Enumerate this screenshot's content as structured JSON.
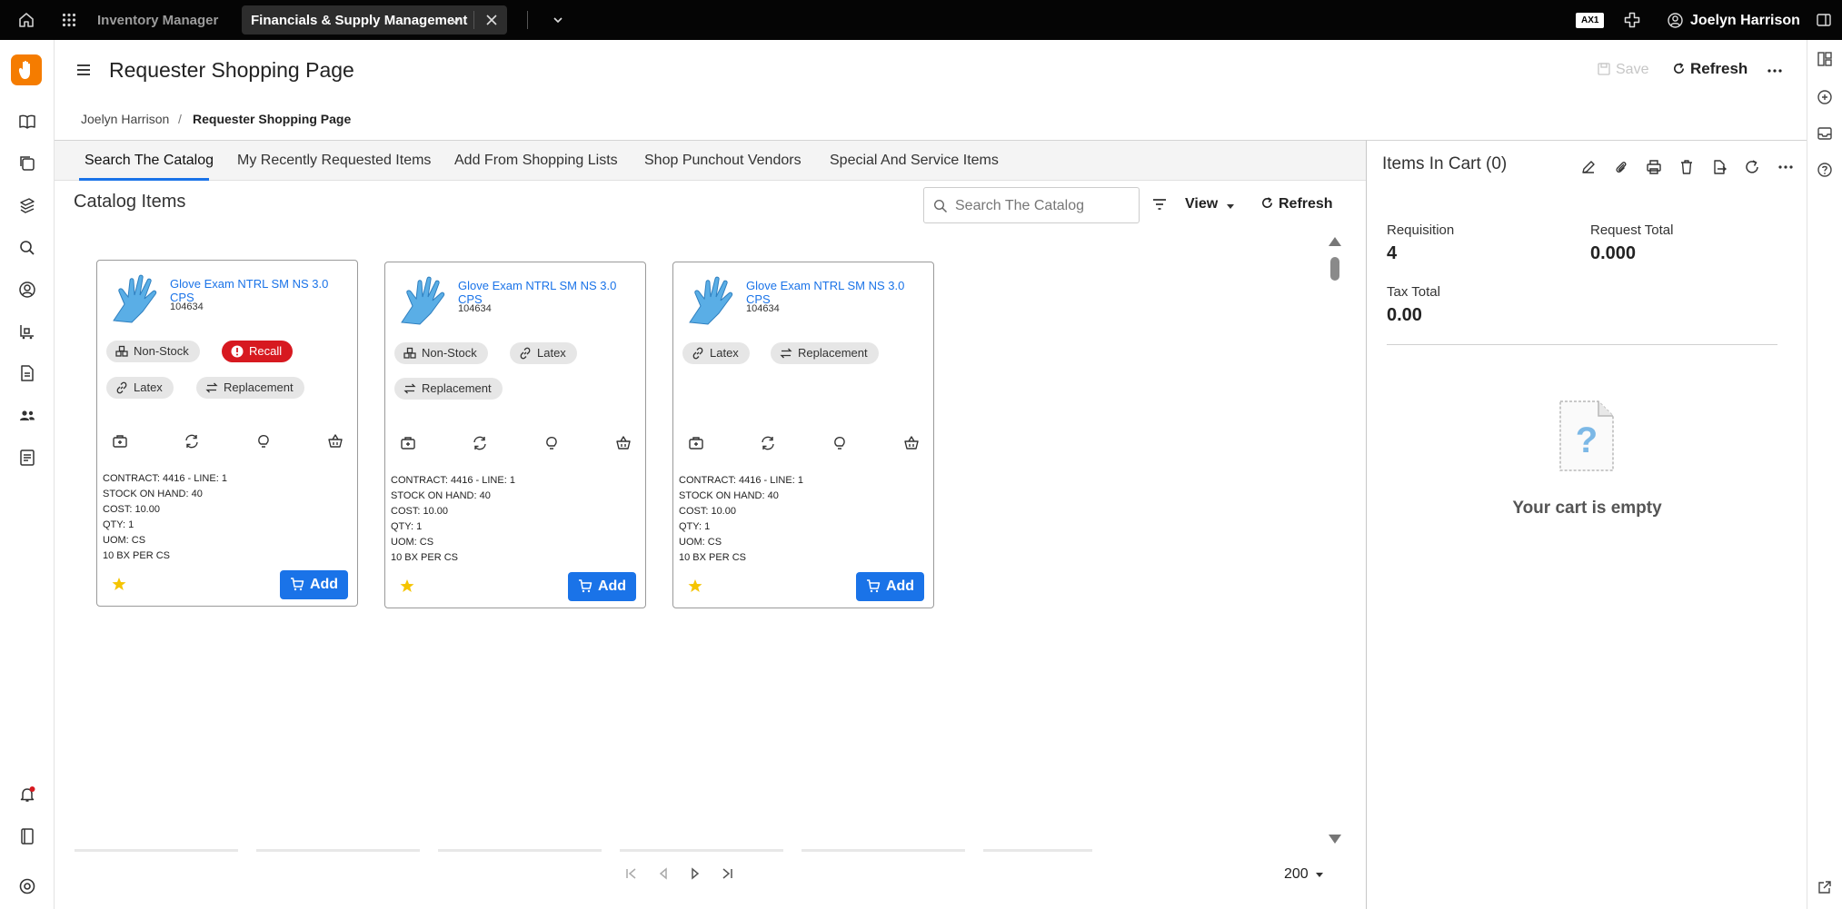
{
  "topbar": {
    "app_name": "Inventory Manager",
    "active_tab": "Financials & Supply Management",
    "badge": "AX1",
    "user_name": "Joelyn Harrison"
  },
  "header": {
    "title": "Requester Shopping Page",
    "save_label": "Save",
    "refresh_label": "Refresh"
  },
  "breadcrumb": {
    "items": [
      "Joelyn Harrison",
      "Requester Shopping Page"
    ],
    "separator": "/"
  },
  "tabs": [
    {
      "label": "Search The Catalog",
      "active": true
    },
    {
      "label": "My Recently Requested Items",
      "active": false
    },
    {
      "label": "Add From Shopping Lists",
      "active": false
    },
    {
      "label": "Shop Punchout Vendors",
      "active": false
    },
    {
      "label": "Special And Service Items",
      "active": false
    }
  ],
  "catalog": {
    "title": "Catalog Items",
    "search_placeholder": "Search The Catalog",
    "view_label": "View",
    "refresh_label": "Refresh",
    "page_size": "200",
    "cards": [
      {
        "name": "Glove Exam NTRL SM NS 3.0 CPS",
        "sku": "104634",
        "tags": [
          {
            "label": "Non-Stock",
            "icon": "inventory-icon",
            "recall": false
          },
          {
            "label": "Recall",
            "icon": "alert-icon",
            "recall": true
          },
          {
            "label": "Latex",
            "icon": "link-icon",
            "recall": false
          },
          {
            "label": "Replacement",
            "icon": "swap-icon",
            "recall": false
          }
        ],
        "meta": [
          "CONTRACT: 4416 - LINE: 1",
          "STOCK ON HAND: 40",
          "COST: 10.00",
          "QTY: 1",
          "UOM: CS",
          "10 BX PER CS"
        ],
        "add_label": "Add"
      },
      {
        "name": "Glove Exam NTRL SM NS 3.0 CPS",
        "sku": "104634",
        "tags": [
          {
            "label": "Non-Stock",
            "icon": "inventory-icon",
            "recall": false
          },
          {
            "label": "Latex",
            "icon": "link-icon",
            "recall": false
          },
          {
            "label": "Replacement",
            "icon": "swap-icon",
            "recall": false
          }
        ],
        "meta": [
          "CONTRACT: 4416 - LINE: 1",
          "STOCK ON HAND: 40",
          "COST: 10.00",
          "QTY: 1",
          "UOM: CS",
          "10 BX PER CS"
        ],
        "add_label": "Add"
      },
      {
        "name": "Glove Exam NTRL SM NS 3.0 CPS",
        "sku": "104634",
        "tags": [
          {
            "label": "Latex",
            "icon": "link-icon",
            "recall": false
          },
          {
            "label": "Replacement",
            "icon": "swap-icon",
            "recall": false
          }
        ],
        "meta": [
          "CONTRACT: 4416 - LINE: 1",
          "STOCK ON HAND: 40",
          "COST: 10.00",
          "QTY: 1",
          "UOM: CS",
          "10 BX PER CS"
        ],
        "add_label": "Add"
      }
    ]
  },
  "cart": {
    "title": "Items In Cart (0)",
    "requisition_label": "Requisition",
    "requisition_value": "4",
    "request_total_label": "Request Total",
    "request_total_value": "0.000",
    "tax_total_label": "Tax Total",
    "tax_total_value": "0.00",
    "empty_text": "Your cart is empty"
  },
  "colors": {
    "accent": "#1a73e8",
    "recall": "#d71920",
    "brand": "#f57c00",
    "topbar": "#050505"
  }
}
